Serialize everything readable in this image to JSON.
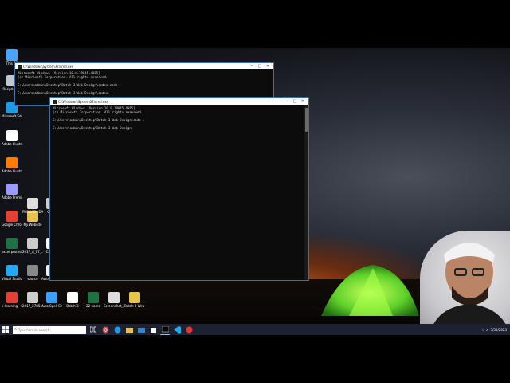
{
  "desktop": {
    "icons": [
      {
        "label": "This PC",
        "color": "#4aa3ff"
      },
      {
        "label": "Recycle Bin",
        "color": "#bfc7d2"
      },
      {
        "label": "Microsoft Edge",
        "color": "#1f9be6"
      },
      {
        "label": "Adobe Illustrat...",
        "color": "#ffffff"
      },
      {
        "label": "Adobe Illustrat...",
        "color": "#ff7c00"
      },
      {
        "label": "Adobe Premiere P...",
        "color": "#9999ff"
      },
      {
        "label": "Google Chrome",
        "color": "#e34133"
      },
      {
        "label": "My Website",
        "color": "#e8c34a"
      },
      {
        "label": "PROKASH DAKRNA",
        "color": "#dddddd"
      },
      {
        "label": "Guy's",
        "color": "#cccccc"
      },
      {
        "label": "excel protesh",
        "color": "#1e7145"
      },
      {
        "label": "2017_8_07_...",
        "color": "#cccccc"
      },
      {
        "label": "CapCut",
        "color": "#ffffff"
      },
      {
        "label": "42D PWNS LIMITED",
        "color": "#2b5797"
      },
      {
        "label": "WhatsApp Image 2023...",
        "color": "#eeeeee"
      },
      {
        "label": "NSD LEVT",
        "color": "#dddddd"
      },
      {
        "label": "Screenshot_9",
        "color": "#ffffff"
      },
      {
        "label": "Visual Studio Code",
        "color": "#23a9f2"
      },
      {
        "label": "source",
        "color": "#888888"
      },
      {
        "label": "Avro Keyboard",
        "color": "#f0f0f0"
      },
      {
        "label": "Doc4",
        "color": "#2b5797"
      },
      {
        "label": "WhatsApp Image 2023...",
        "color": "#eeeeee"
      },
      {
        "label": "download",
        "color": "#dddddd"
      },
      {
        "label": "digital-mar...",
        "color": "#c94bd6"
      },
      {
        "label": "e-learning - Chrome",
        "color": "#e34133"
      },
      {
        "label": "2017_2785...",
        "color": "#cccccc"
      },
      {
        "label": "Avro Spell Checker",
        "color": "#3aa0ff"
      },
      {
        "label": "Batch 3",
        "color": "#ffffff"
      },
      {
        "label": "22-name",
        "color": "#1e7145"
      },
      {
        "label": "Screenshot_3",
        "color": "#dddddd"
      },
      {
        "label": "Batch 3 Web Design",
        "color": "#e8c34a"
      }
    ]
  },
  "terminal_back": {
    "title": "C:\\Windows\\System32\\cmd.exe",
    "lines": [
      "Microsoft Windows [Version 10.0.19045.4085]",
      "(c) Microsoft Corporation. All rights reserved.",
      "",
      "C:\\Users\\admin\\Desktop\\Batch 3 Web Design\\codes>code .",
      "",
      "C:\\Users\\admin\\Desktop\\Batch 3 Web Design\\codes>"
    ]
  },
  "terminal_front": {
    "title": "C:\\Windows\\System32\\cmd.exe",
    "lines": [
      "Microsoft Windows [Version 10.0.19045.4085]",
      "(c) Microsoft Corporation. All rights reserved.",
      "",
      "C:\\Users\\admin\\Desktop\\Batch 3 Web Design>code .",
      "",
      "C:\\Users\\admin\\Desktop\\Batch 3 Web Design>"
    ]
  },
  "taskbar": {
    "search_placeholder": "Type here to search",
    "clock_time": "",
    "clock_date": "7/30/2023"
  }
}
